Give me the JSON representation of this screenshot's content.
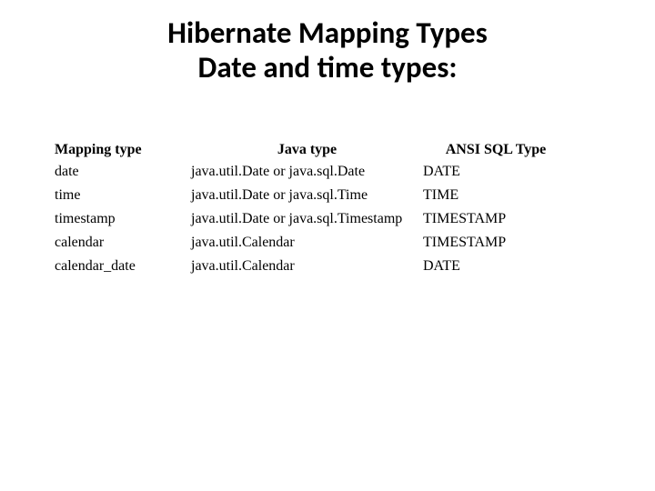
{
  "title": {
    "line1": "Hibernate Mapping Types",
    "line2": "Date and time types:"
  },
  "table": {
    "headers": {
      "c0": "Mapping type",
      "c1": "Java type",
      "c2": "ANSI SQL Type"
    },
    "rows": [
      {
        "c0": "date",
        "c1": "java.util.Date or java.sql.Date",
        "c2": "DATE"
      },
      {
        "c0": "time",
        "c1": "java.util.Date or java.sql.Time",
        "c2": "TIME"
      },
      {
        "c0": "timestamp",
        "c1": "java.util.Date or java.sql.Timestamp",
        "c2": "TIMESTAMP"
      },
      {
        "c0": "calendar",
        "c1": "java.util.Calendar",
        "c2": "TIMESTAMP"
      },
      {
        "c0": "calendar_date",
        "c1": "java.util.Calendar",
        "c2": "DATE"
      }
    ]
  }
}
